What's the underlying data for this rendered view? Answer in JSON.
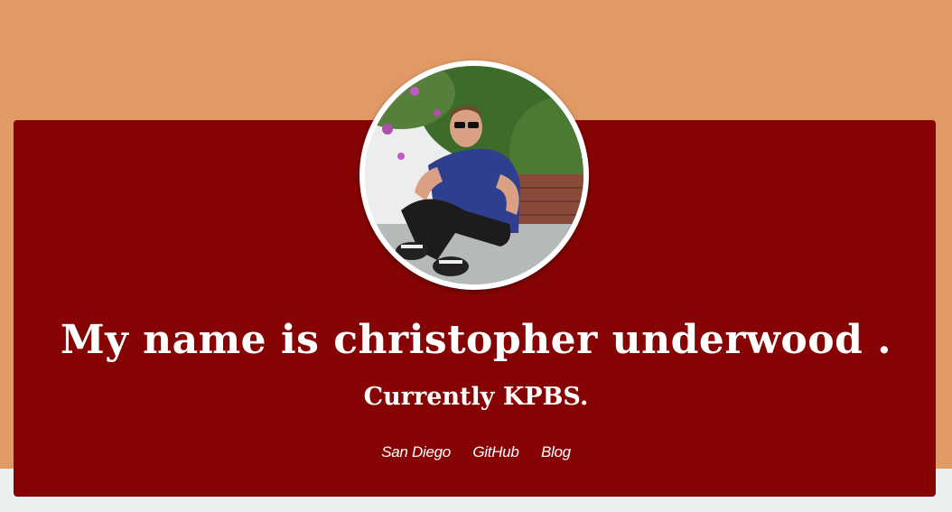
{
  "profile": {
    "avatar_alt": "christopher underwood",
    "headline": "My name is christopher underwood .",
    "subhead": "Currently KPBS."
  },
  "links": [
    {
      "label": "San Diego"
    },
    {
      "label": "GitHub"
    },
    {
      "label": "Blog"
    }
  ],
  "colors": {
    "background_top": "#e19a66",
    "background_bottom": "#ecefef",
    "card": "#860404",
    "text": "#ffffff"
  }
}
